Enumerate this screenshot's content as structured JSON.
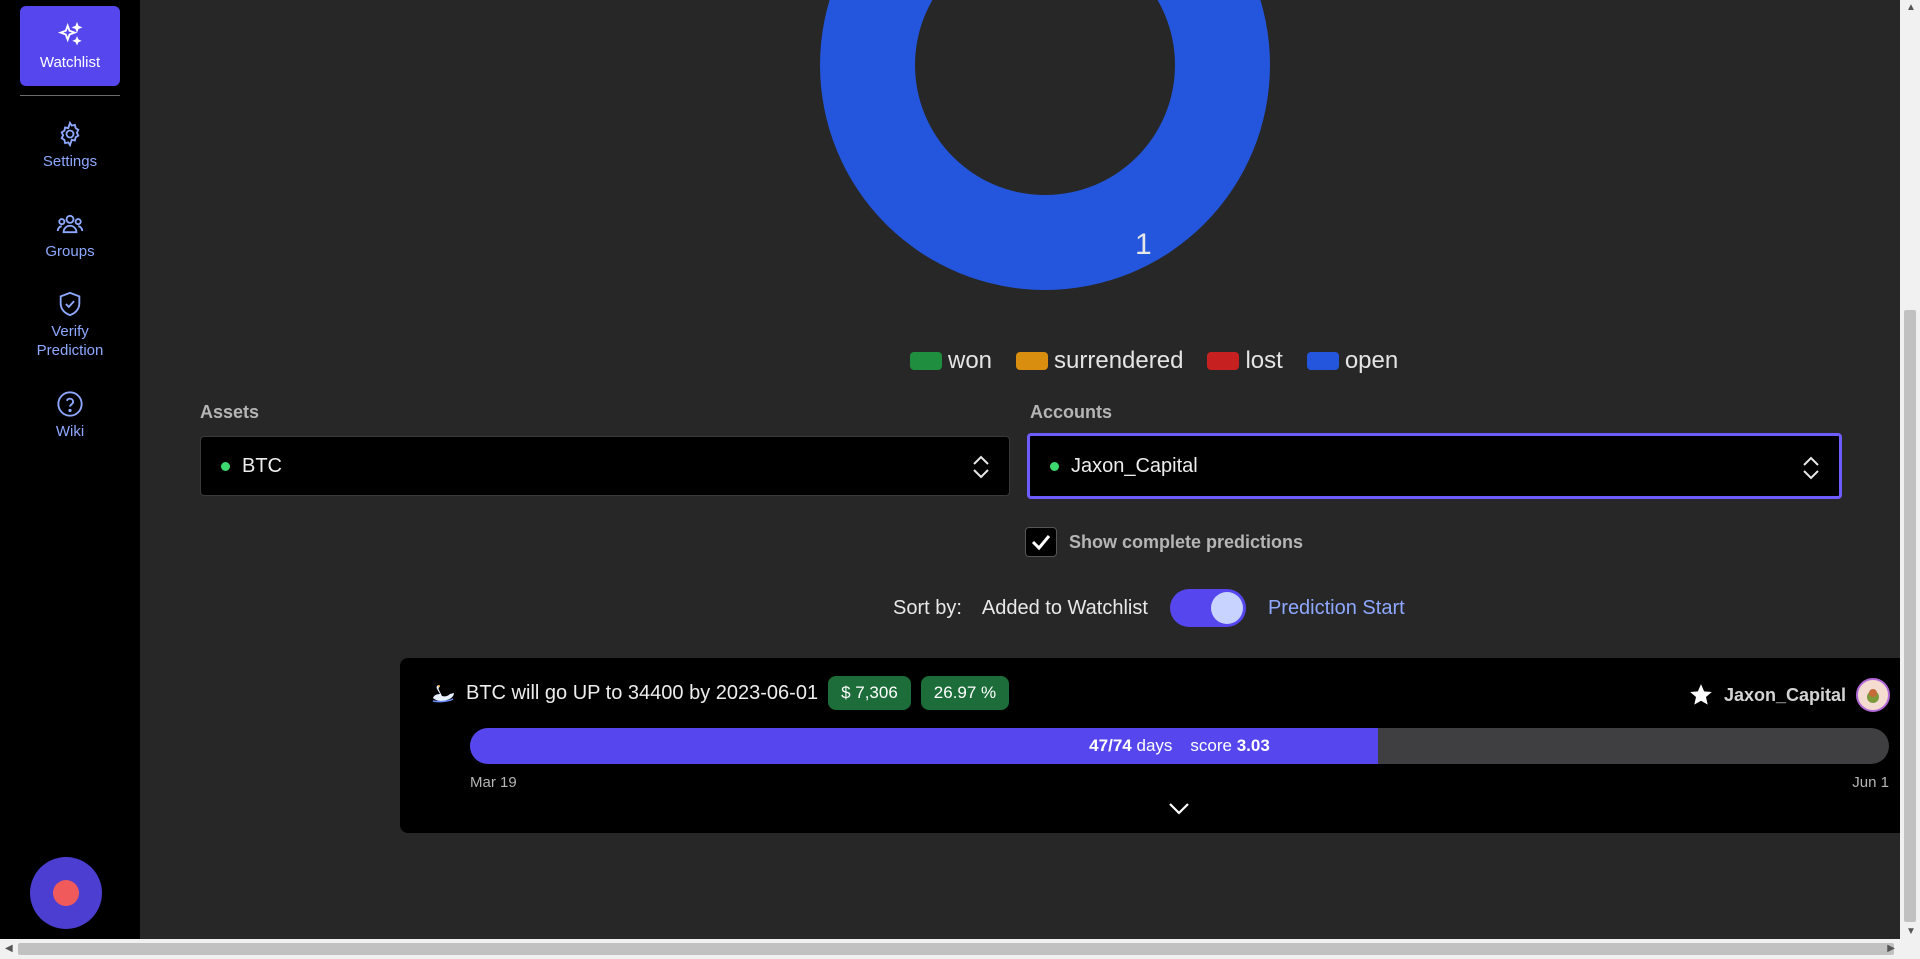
{
  "sidebar": {
    "items": [
      {
        "label": "Watchlist",
        "icon": "sparkles-icon"
      },
      {
        "label": "Settings",
        "icon": "gear-icon"
      },
      {
        "label": "Groups",
        "icon": "users-icon"
      },
      {
        "label": "Verify Prediction",
        "icon": "shield-check-icon"
      },
      {
        "label": "Wiki",
        "icon": "question-circle-icon"
      }
    ]
  },
  "chart_data": {
    "type": "pie",
    "categories": [
      "won",
      "surrendered",
      "lost",
      "open"
    ],
    "values": [
      0,
      0,
      0,
      1
    ],
    "data_labels": [
      "1"
    ],
    "colors": {
      "won": "#1f8f3f",
      "surrendered": "#d98e10",
      "lost": "#c62020",
      "open": "#2356dc"
    }
  },
  "legend": {
    "items": [
      {
        "label": "won",
        "color": "#1f8f3f"
      },
      {
        "label": "surrendered",
        "color": "#d98e10"
      },
      {
        "label": "lost",
        "color": "#c62020"
      },
      {
        "label": "open",
        "color": "#2356dc"
      }
    ]
  },
  "filters": {
    "assets_label": "Assets",
    "assets_value": "BTC",
    "accounts_label": "Accounts",
    "accounts_value": "Jaxon_Capital"
  },
  "show_complete": {
    "label": "Show complete predictions",
    "checked": true
  },
  "sort": {
    "label": "Sort by:",
    "option_left": "Added to Watchlist",
    "option_right": "Prediction Start",
    "toggled": true
  },
  "prediction": {
    "title": "BTC will go UP to 34400 by 2023-06-01",
    "price_badge": "$ 7,306",
    "percent_badge": "26.97 %",
    "account": "Jaxon_Capital",
    "days_done": "47",
    "days_total": "74",
    "days_text": "days",
    "score_label": "score",
    "score_value": "3.03",
    "progress": 0.64,
    "start_date": "Mar 19",
    "end_date": "Jun 1"
  },
  "colors": {
    "accent": "#5546ee",
    "badge_green": "#1d6d3a"
  }
}
